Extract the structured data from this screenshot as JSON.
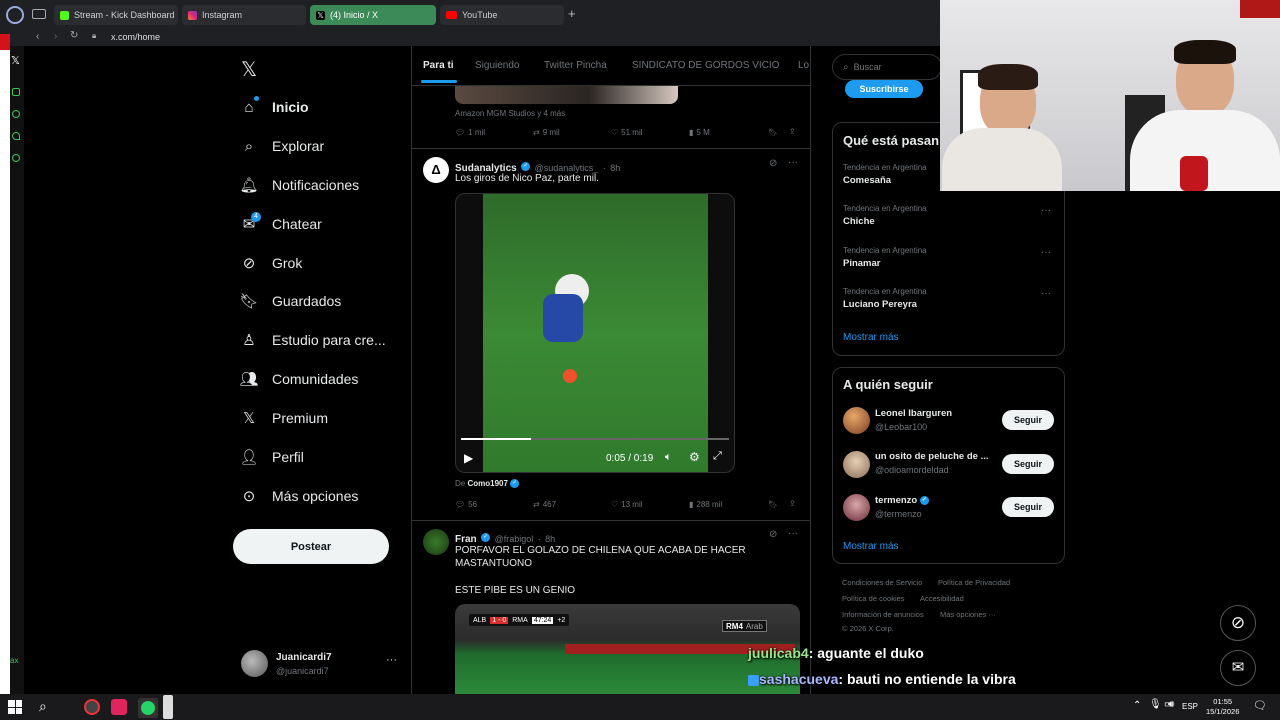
{
  "browser": {
    "tabs": [
      {
        "label": "Stream - Kick Dashboard",
        "color": "#53fc18"
      },
      {
        "label": "Instagram",
        "color": "#e1306c"
      },
      {
        "label": "(4) Inicio / X",
        "color": "#000000"
      },
      {
        "label": "YouTube",
        "color": "#ff0000"
      }
    ],
    "url": "x.com/home"
  },
  "sidebar": {
    "items": [
      {
        "label": "Inicio",
        "icon": "home-icon"
      },
      {
        "label": "Explorar",
        "icon": "search-icon"
      },
      {
        "label": "Notificaciones",
        "icon": "bell-icon"
      },
      {
        "label": "Chatear",
        "icon": "mail-icon",
        "badge": "4"
      },
      {
        "label": "Grok",
        "icon": "grok-icon"
      },
      {
        "label": "Guardados",
        "icon": "bookmark-icon"
      },
      {
        "label": "Estudio para cre...",
        "icon": "studio-icon"
      },
      {
        "label": "Comunidades",
        "icon": "communities-icon"
      },
      {
        "label": "Premium",
        "icon": "x-icon"
      },
      {
        "label": "Perfil",
        "icon": "person-icon"
      },
      {
        "label": "Más opciones",
        "icon": "more-icon"
      }
    ],
    "post_label": "Postear",
    "account": {
      "name": "Juanicardi7",
      "handle": "@juanicardi7"
    }
  },
  "feed": {
    "tabs": [
      "Para ti",
      "Siguiendo",
      "Twitter Pincha",
      "SINDICATO DE GORDOS VICIO",
      "Lo"
    ],
    "post0": {
      "attribution": "Amazon MGM Studios y 4 más",
      "replies": "1 mil",
      "reposts": "9 mil",
      "likes": "51 mil",
      "views": "5 M"
    },
    "post1": {
      "name": "Sudanalytics",
      "handle": "@sudanalytics_",
      "time": "8h",
      "text": "Los giros de Nico Paz, parte mil.",
      "video_time": "0:05 / 0:19",
      "video_progress": 0.26,
      "source_prefix": "De",
      "source_name": "Como1907",
      "replies": "56",
      "reposts": "467",
      "likes": "13 mil",
      "views": "288 mil"
    },
    "post2": {
      "name": "Fran",
      "handle": "@frabigol",
      "time": "8h",
      "text": "PORFAVOR EL GOLAZO DE CHILENA QUE ACABA DE HACER MASTANTUONO",
      "text2": "ESTE PIBE ES UN GENIO",
      "score_home": "ALB",
      "score": "1 - 0",
      "score_away": "RMA",
      "clock": "47:24",
      "added": "+2",
      "channel": "RM4",
      "channel2": "Arab"
    }
  },
  "right": {
    "search_placeholder": "Buscar",
    "subscribe_label": "Suscribirse",
    "trends_title": "Qué está pasan",
    "trends": [
      {
        "category": "Tendencia en Argentina",
        "name": "Comesaña"
      },
      {
        "category": "Tendencia en Argentina",
        "name": "Chiche"
      },
      {
        "category": "Tendencia en Argentina",
        "name": "Pinamar"
      },
      {
        "category": "Tendencia en Argentina",
        "name": "Luciano Pereyra"
      }
    ],
    "show_more": "Mostrar más",
    "follow_title": "A quién seguir",
    "follow": [
      {
        "name": "Leonel Ibarguren",
        "handle": "@Leobar100"
      },
      {
        "name": "un osito de peluche de ...",
        "handle": "@odioamordeldad"
      },
      {
        "name": "termenzo",
        "handle": "@termenzo"
      }
    ],
    "follow_label": "Seguir",
    "show_more2": "Mostrar más",
    "footer": [
      "Condiciones de Servicio",
      "Política de Privacidad",
      "Política de cookies",
      "Accesibilidad",
      "Información de anuncios",
      "Más opciones ···",
      "© 2026 X Corp."
    ]
  },
  "overlay": {
    "chat": [
      {
        "user": "juulicab4",
        "msg": ": aguante el duko",
        "color": "#9be38b"
      },
      {
        "user": "sashacueva",
        "msg": ": bauti no entiende la vibra",
        "color": "#a9b8ff"
      }
    ],
    "side_text": "ax"
  },
  "taskbar": {
    "lang": "ESP",
    "time": "01:55",
    "date": "15/1/2026"
  }
}
